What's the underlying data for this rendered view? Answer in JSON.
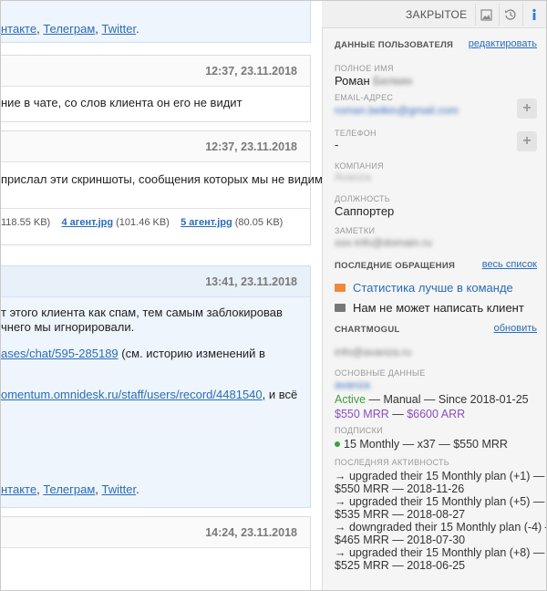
{
  "topbar": {
    "status": "ЗАКРЫТОЕ"
  },
  "messages": [
    {
      "links": [
        "нтакте",
        "Телеграм",
        "Twitter"
      ]
    },
    {
      "time": "12:37, 23.11.2018",
      "text": "ние в чате, со слов клиента он его не видит"
    },
    {
      "time": "12:37, 23.11.2018",
      "text": "прислал эти скриншоты, сообщения которых мы не видим",
      "attachments": [
        {
          "size": "118.55 KB)"
        },
        {
          "name": "4 агент.jpg",
          "size": "(101.46 KB)"
        },
        {
          "name": "5 агент.jpg",
          "size": "(80.05 KB)"
        }
      ]
    },
    {
      "time": "13:41, 23.11.2018",
      "line1": "т этого клиента как спам, тем самым заблокировав",
      "line2": "чнего мы игнорировали.",
      "link1": "ases/chat/595-285189",
      "line3_suffix": " (см. историю изменений в",
      "link2": "omentum.omnidesk.ru/staff/users/record/4481540",
      "line4_suffix": ", и всё",
      "links": [
        "нтакте",
        "Телеграм",
        "Twitter"
      ]
    },
    {
      "time": "14:24, 23.11.2018"
    }
  ],
  "user": {
    "title": "ДАННЫЕ ПОЛЬЗОВАТЕЛЯ",
    "edit": "редактировать",
    "name_label": "ПОЛНОЕ ИМЯ",
    "name": "Роман",
    "name_blur": "Белкин",
    "email_label": "EMAIL-АДРЕС",
    "email_blur": "roman.belkin@gmail.com",
    "phone_label": "ТЕЛЕФОН",
    "phone": "-",
    "company_label": "КОМПАНИЯ",
    "company_blur": "Avanza",
    "position_label": "ДОЛЖНОСТЬ",
    "position": "Саппортер",
    "notes_label": "ЗАМЕТКИ",
    "notes_blur": "xxx-info@domain.ru"
  },
  "requests": {
    "title": "ПОСЛЕДНИЕ ОБРАЩЕНИЯ",
    "all": "весь список",
    "items": [
      "Статистика лучше в команде",
      "Нам не может написать клиент"
    ],
    "colors": [
      "#f0883c",
      "#777777"
    ]
  },
  "chartmogul": {
    "title": "CHARTMOGUL",
    "refresh": "обновить",
    "email_blur": "info@avanza.ru",
    "basic_label": "ОСНОВНЫЕ ДАННЫЕ",
    "basic_blur": "avanza",
    "status": "Active",
    "plan_info": " — Manual — Since 2018-01-25",
    "mrr": "$550 MRR",
    "arr": "$6600 ARR",
    "subs_label": "ПОДПИСКИ",
    "subscription": "15 Monthly — x37 — $550 MRR",
    "activity_label": "ПОСЛЕДНЯЯ АКТИВНОСТЬ",
    "activity": [
      "→ upgraded their 15 Monthly plan (+1) —",
      "$550 MRR — 2018-11-26",
      "→ upgraded their 15 Monthly plan (+5) —",
      "$535 MRR — 2018-08-27",
      "→ downgraded their 15 Monthly plan (-4) —",
      "$465 MRR — 2018-07-30",
      "→ upgraded their 15 Monthly plan (+8) —",
      "$525 MRR — 2018-06-25"
    ]
  }
}
